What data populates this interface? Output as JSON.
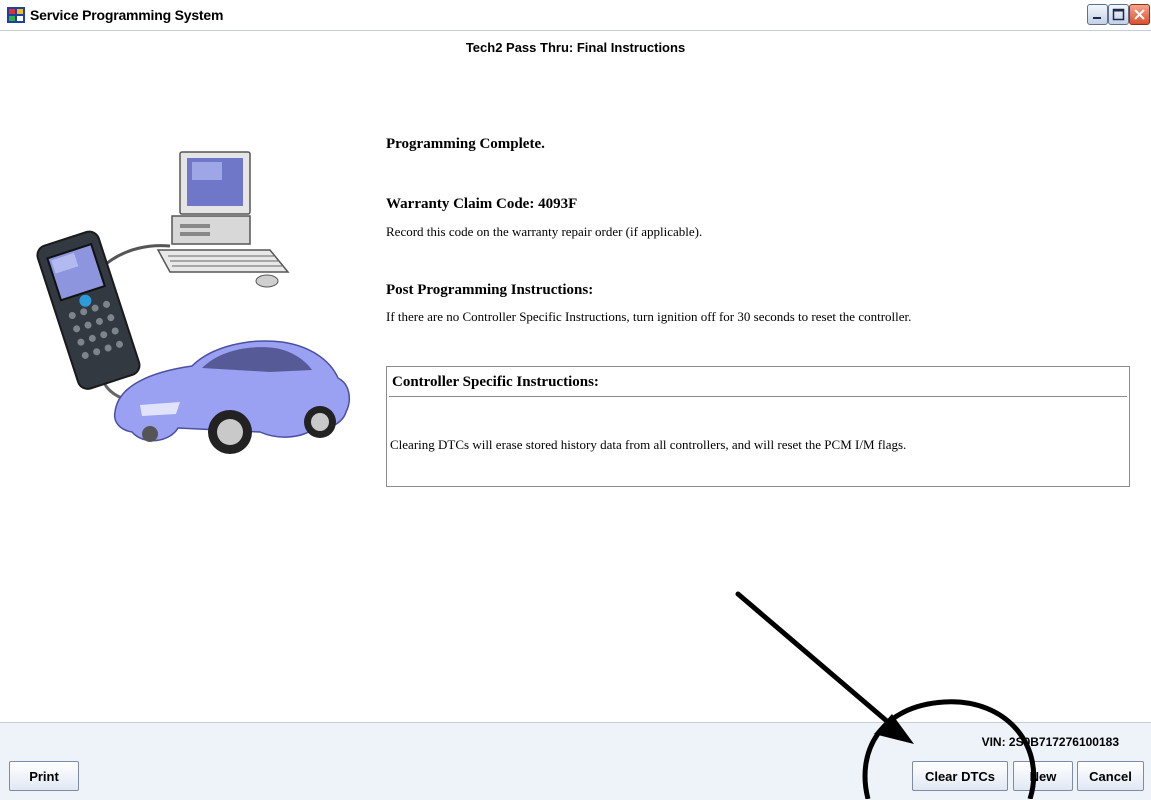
{
  "window": {
    "title": "Service Programming System"
  },
  "header": {
    "subtitle": "Tech2 Pass Thru:  Final Instructions"
  },
  "main": {
    "programming_complete": "Programming Complete.",
    "warranty_label": "Warranty Claim Code: 4093F",
    "warranty_note": "Record this code on the warranty repair order (if applicable).",
    "post_title": "Post Programming Instructions:",
    "post_text": "If there are no Controller Specific Instructions, turn ignition off for 30 seconds to reset the controller.",
    "csi": {
      "title": "Controller Specific Instructions:",
      "text": "Clearing DTCs will erase stored history data from all controllers, and will reset the PCM I/M flags."
    }
  },
  "status": {
    "vin": "VIN: 2S0B717276100183"
  },
  "buttons": {
    "print": "Print",
    "clear_dtcs": "Clear DTCs",
    "new": "New",
    "cancel": "Cancel"
  },
  "icons": [
    "app-icon",
    "minimize-icon",
    "maximize-icon",
    "close-icon"
  ],
  "colors": {
    "status_panel": "#eef2f9",
    "car": "#9aa0f2",
    "close_button": "#d9502e"
  }
}
